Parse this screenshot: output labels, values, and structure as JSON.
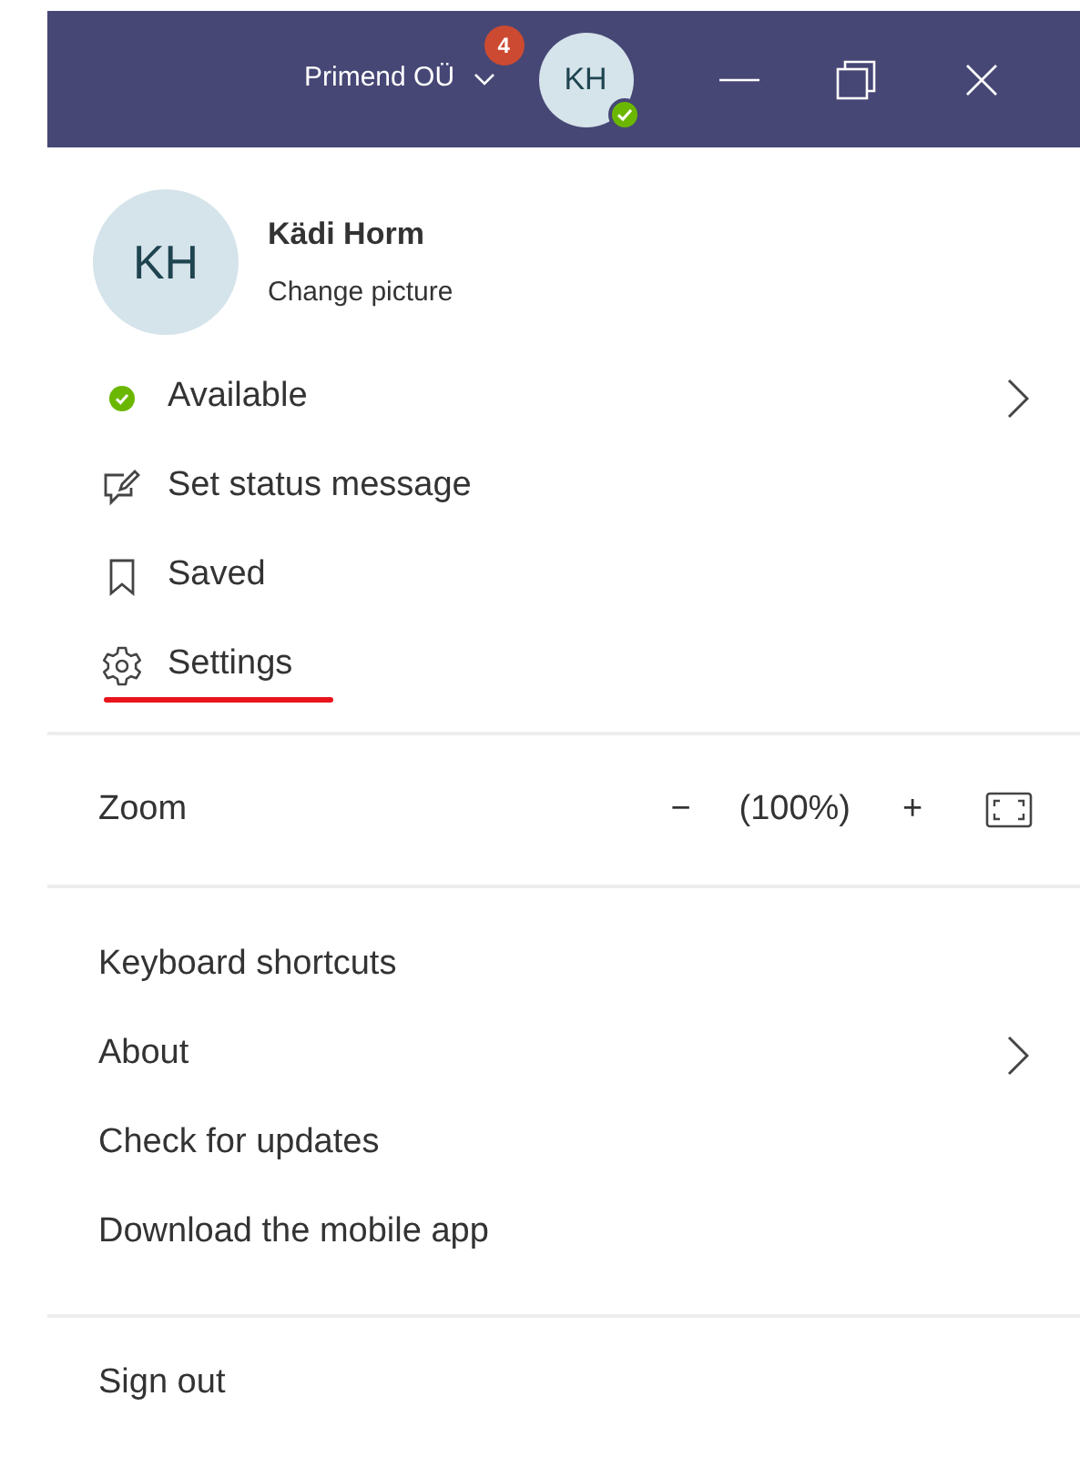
{
  "title_bar": {
    "org": "Primend OÜ",
    "badge": "4",
    "avatar": "KH",
    "available": true
  },
  "profile": {
    "avatar": "KH",
    "name": "Kädi Horm",
    "action": "Change picture"
  },
  "status_items": [
    {
      "kind": "presence",
      "label": "Available",
      "submenu": true,
      "underlined": false
    },
    {
      "kind": "status-message",
      "label": "Set status message",
      "submenu": false,
      "underlined": false
    },
    {
      "kind": "saved",
      "label": "Saved",
      "submenu": false,
      "underlined": false
    },
    {
      "kind": "settings",
      "label": "Settings",
      "submenu": false,
      "underlined": true
    }
  ],
  "zoom": {
    "label": "Zoom",
    "minus": "−",
    "value": "(100%)",
    "plus": "+"
  },
  "app_items": [
    {
      "label": "Keyboard shortcuts",
      "submenu": false
    },
    {
      "label": "About",
      "submenu": true
    },
    {
      "label": "Check for updates",
      "submenu": false
    },
    {
      "label": "Download the mobile app",
      "submenu": false
    }
  ],
  "sign_out": "Sign out"
}
